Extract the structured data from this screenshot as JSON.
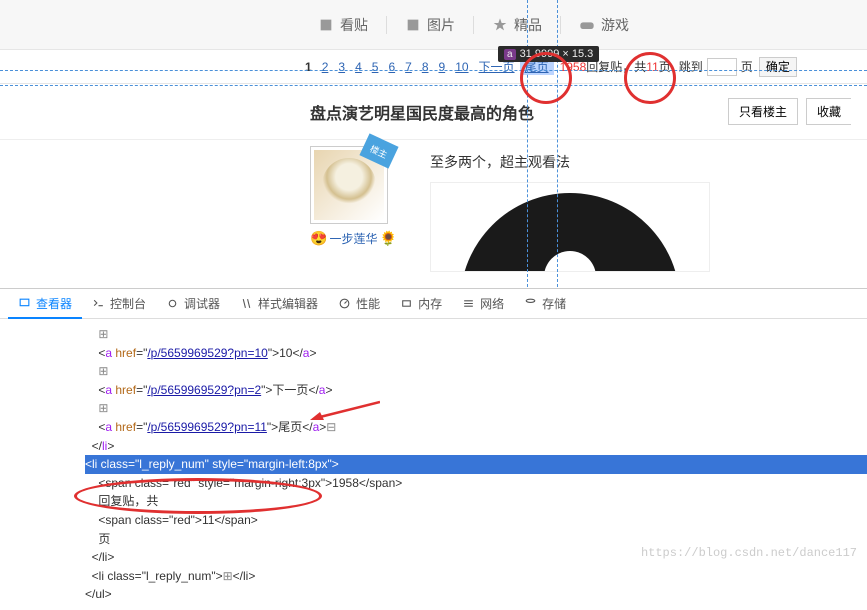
{
  "tabs": {
    "view": "看贴",
    "image": "图片",
    "featured": "精品",
    "game": "游戏"
  },
  "pager": {
    "pages": [
      "1",
      "2",
      "3",
      "4",
      "5",
      "6",
      "7",
      "8",
      "9",
      "10"
    ],
    "next": "下一页",
    "last": "尾页",
    "replies": "1958",
    "reply_suffix": "回复贴，共",
    "total_pages": "11",
    "page_word": "页",
    "jump": "跳到",
    "unit": "页",
    "go": "确定"
  },
  "title": "盘点演艺明星国民度最高的角色",
  "actions": {
    "only_op": "只看楼主",
    "collect": "收藏"
  },
  "owner_badge": "楼主",
  "username": "一步莲华",
  "post_text": "至多两个，超主观看法",
  "tooltip": {
    "tag": "a",
    "dims": "31.9999 × 15.3"
  },
  "devtools": {
    "tabs": {
      "inspect": "查看器",
      "console": "控制台",
      "debugger": "调试器",
      "styles": "样式编辑器",
      "perf": "性能",
      "memory": "内存",
      "network": "网络",
      "storage": "存储"
    },
    "code": {
      "url10": "/p/5659969529?pn=10",
      "txt10": "10",
      "url2": "/p/5659969529?pn=2",
      "txtNext": "下一页",
      "url11": "/p/5659969529?pn=11",
      "txtLast": "尾页",
      "li_open": "<li class=\"l_reply_num\" style=\"margin-left:8px\">",
      "span1a": "<span class=\"red\" style=\"margin-right:3px\">",
      "num1958": "1958",
      "span1b": "</span>",
      "huifu": "回复贴，共",
      "span2a": "<span class=\"red\">",
      "num11": "11",
      "span2b": "</span>",
      "ye": "页",
      "cli": "</li>",
      "li2": "<li class=\"l_reply_num\">",
      "dots": "…",
      "cli2": "</li>",
      "cul": "</ul>"
    }
  },
  "watermark": "https://blog.csdn.net/dance117"
}
